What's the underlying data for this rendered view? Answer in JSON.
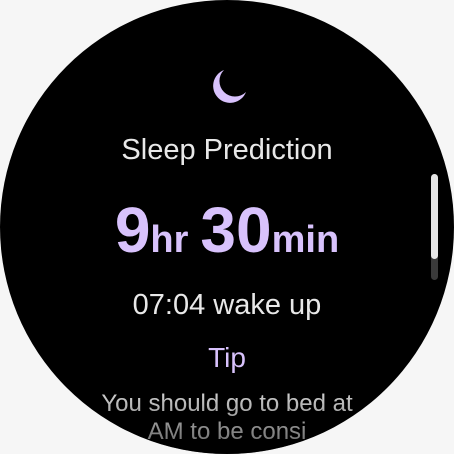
{
  "screen": {
    "title": "Sleep Prediction",
    "icon": "moon-icon",
    "accent_color": "#d8c2fc"
  },
  "prediction": {
    "hours": "9",
    "hours_unit": "hr",
    "minutes": "30",
    "minutes_unit": "min",
    "wake_time_text": "07:04 wake up"
  },
  "tip": {
    "label": "Tip",
    "body": "You should go to bed at AM to be consi"
  },
  "scroll": {
    "position_fraction": 0.0,
    "visible_fraction": 0.8
  }
}
